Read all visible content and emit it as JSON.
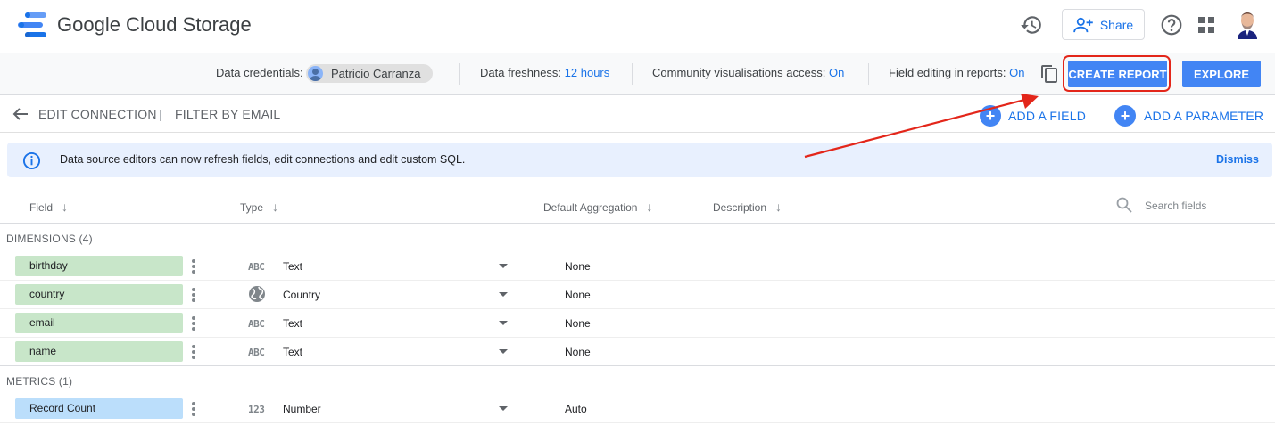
{
  "header": {
    "title": "Google Cloud Storage",
    "share_label": "Share"
  },
  "bar": {
    "credentials_label": "Data credentials:",
    "credentials_user": "Patricio Carranza",
    "freshness_label": "Data freshness:",
    "freshness_value": "12 hours",
    "community_label": "Community visualisations access:",
    "community_value": "On",
    "field_editing_label": "Field editing in reports:",
    "field_editing_value": "On",
    "create_report": "CREATE REPORT",
    "explore": "EXPLORE"
  },
  "nav": {
    "edit_connection": "EDIT CONNECTION",
    "separator": "|",
    "filter": "FILTER BY EMAIL",
    "add_field": "ADD A FIELD",
    "add_parameter": "ADD A PARAMETER"
  },
  "banner": {
    "text": "Data source editors can now refresh fields, edit connections and edit custom SQL.",
    "dismiss": "Dismiss"
  },
  "columns": {
    "field": "Field",
    "type": "Type",
    "aggregation": "Default Aggregation",
    "description": "Description",
    "search_placeholder": "Search fields"
  },
  "dimensions": {
    "label": "DIMENSIONS (4)",
    "rows": [
      {
        "field": "birthday",
        "type_icon": "ABC",
        "type": "Text",
        "aggregation": "None"
      },
      {
        "field": "country",
        "type_icon": "globe-icon",
        "type": "Country",
        "aggregation": "None"
      },
      {
        "field": "email",
        "type_icon": "ABC",
        "type": "Text",
        "aggregation": "None"
      },
      {
        "field": "name",
        "type_icon": "ABC",
        "type": "Text",
        "aggregation": "None"
      }
    ]
  },
  "metrics": {
    "label": "METRICS (1)",
    "rows": [
      {
        "field": "Record Count",
        "type_icon": "123",
        "type": "Number",
        "aggregation": "Auto"
      }
    ]
  },
  "colors": {
    "accent": "#4285f4",
    "link": "#1a73e8",
    "dimension": "#c8e6c9",
    "metric": "#bbdefb",
    "annotation": "#e3261a"
  }
}
